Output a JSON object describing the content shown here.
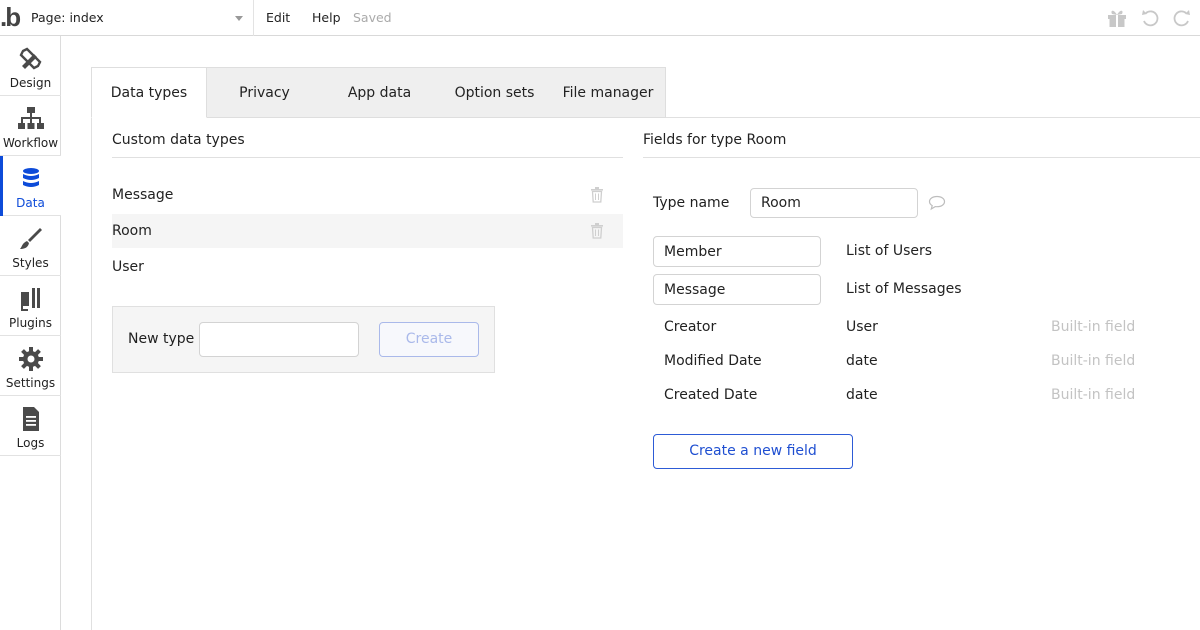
{
  "topbar": {
    "page_label": "Page: index",
    "menu": {
      "edit": "Edit",
      "help": "Help",
      "status": "Saved"
    },
    "icons": [
      "gift-icon",
      "undo-icon",
      "redo-icon"
    ]
  },
  "sidebar": {
    "items": [
      {
        "label": "Design",
        "icon": "design-icon"
      },
      {
        "label": "Workflow",
        "icon": "workflow-icon"
      },
      {
        "label": "Data",
        "icon": "database-icon",
        "active": true
      },
      {
        "label": "Styles",
        "icon": "brush-icon"
      },
      {
        "label": "Plugins",
        "icon": "plugin-icon"
      },
      {
        "label": "Settings",
        "icon": "gear-icon"
      },
      {
        "label": "Logs",
        "icon": "document-icon"
      }
    ],
    "accent": "#0d4bd9"
  },
  "tabs": [
    {
      "label": "Data types",
      "active": true
    },
    {
      "label": "Privacy"
    },
    {
      "label": "App data"
    },
    {
      "label": "Option sets"
    },
    {
      "label": "File manager"
    }
  ],
  "custom_types": {
    "title": "Custom data types",
    "items": [
      "Message",
      "Room",
      "User"
    ],
    "selected": "Room",
    "new_type_label": "New type",
    "new_type_value": "",
    "create_label": "Create"
  },
  "fields": {
    "title": "Fields for type Room",
    "type_name_label": "Type name",
    "type_name_value": "Room",
    "custom": [
      {
        "name": "Member",
        "type": "List of Users"
      },
      {
        "name": "Message",
        "type": "List of Messages"
      }
    ],
    "builtin": [
      {
        "name": "Creator",
        "type": "User",
        "note": "Built-in field"
      },
      {
        "name": "Modified Date",
        "type": "date",
        "note": "Built-in field"
      },
      {
        "name": "Created Date",
        "type": "date",
        "note": "Built-in field"
      }
    ],
    "create_field_label": "Create a new field"
  }
}
